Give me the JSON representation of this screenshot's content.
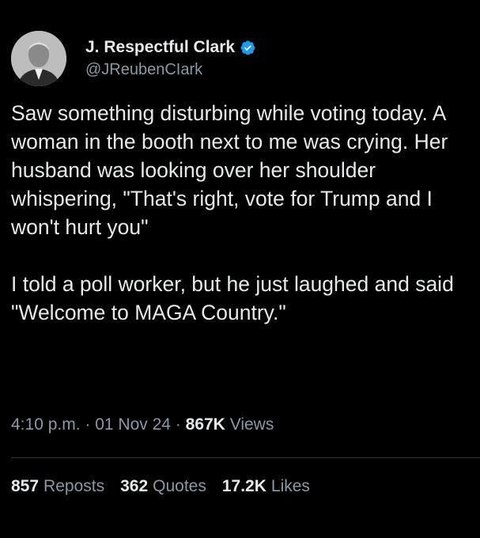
{
  "author": {
    "display_name": "J. Respectful Clark",
    "handle": "@JReubenCIark",
    "verified_icon": "verified-badge-icon",
    "verified_color": "#1d9bf0"
  },
  "tweet": {
    "paragraphs": [
      "Saw something disturbing while voting today. A woman in the booth next to me was crying. Her husband was looking over her shoulder whispering, \"That's right, vote for Trump and I won't hurt you\"",
      "I told a poll worker, but he just laughed and said \"Welcome to MAGA Country.\""
    ]
  },
  "meta": {
    "time": "4:10 p.m.",
    "separator": "·",
    "date": "01 Nov 24",
    "views_count": "867K",
    "views_label": "Views"
  },
  "stats": {
    "reposts_count": "857",
    "reposts_label": "Reposts",
    "quotes_count": "362",
    "quotes_label": "Quotes",
    "likes_count": "17.2K",
    "likes_label": "Likes"
  },
  "colors": {
    "background": "#000000",
    "primary_text": "#e7e9ea",
    "secondary_text": "#8b98a5",
    "divider": "#2f3336"
  }
}
